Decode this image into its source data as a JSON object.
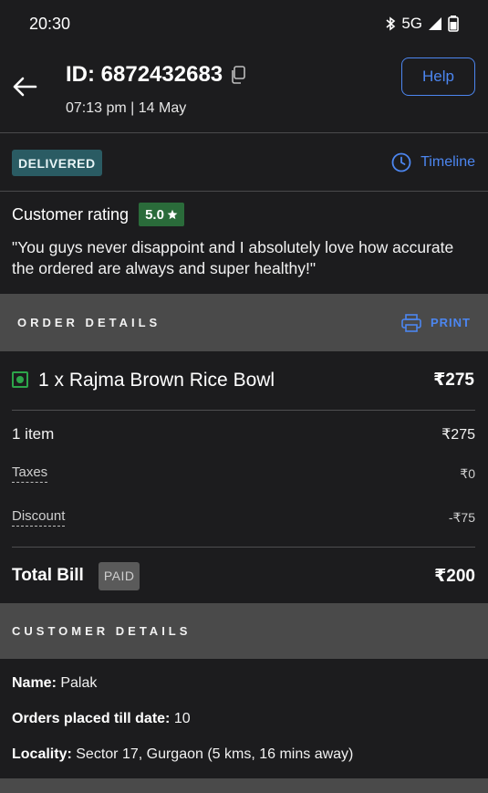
{
  "status_bar": {
    "time": "20:30",
    "network": "5G"
  },
  "header": {
    "order_id": "ID: 6872432683",
    "order_time": "07:13 pm | 14 May",
    "help_label": "Help"
  },
  "order_status": {
    "badge": "DELIVERED",
    "timeline_label": "Timeline"
  },
  "rating": {
    "label": "Customer rating",
    "value": "5.0",
    "comment": "\"You guys never disappoint and I absolutely love how accurate the ordered are always and super healthy!\""
  },
  "order_details": {
    "title": "ORDER DETAILS",
    "print_label": "PRINT",
    "item": {
      "name": "1 x Rajma Brown Rice Bowl",
      "price": "₹275"
    },
    "items_count_label": "1 item",
    "items_subtotal": "₹275",
    "taxes_label": "Taxes",
    "taxes_value": "₹0",
    "discount_label": "Discount",
    "discount_value": "-₹75",
    "total_label": "Total Bill",
    "paid_badge": "PAID",
    "total_value": "₹200"
  },
  "customer_details": {
    "title": "CUSTOMER DETAILS",
    "name_label": "Name:",
    "name_value": "Palak",
    "orders_label": "Orders placed till date:",
    "orders_value": "10",
    "locality_label": "Locality:",
    "locality_value": "Sector 17, Gurgaon (5 kms, 16 mins away)"
  },
  "colors": {
    "background": "#1c1c1e",
    "accent_blue": "#4c86f0",
    "delivered_badge": "#2a5b63",
    "rating_badge": "#2a6b3a",
    "veg_green": "#2da54a",
    "section_header": "#4a4a4a"
  },
  "icons": {
    "back": "arrow-left-icon",
    "copy": "copy-icon",
    "timeline": "clock-icon",
    "print": "printer-icon",
    "rating_star": "star-icon",
    "veg": "veg-indicator-icon"
  }
}
